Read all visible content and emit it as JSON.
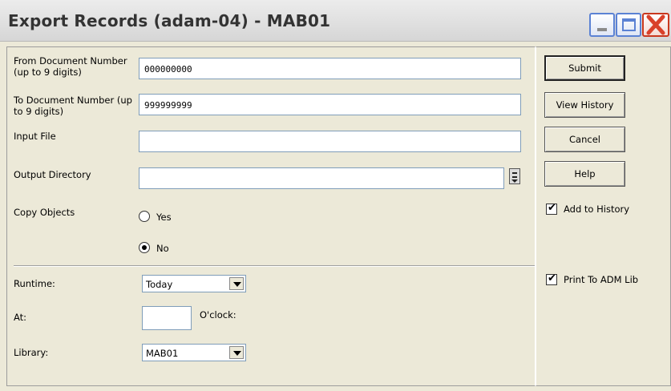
{
  "window": {
    "title": "Export Records (adam-04) - MAB01"
  },
  "form": {
    "from_doc": {
      "label": "From Document Number (up to 9 digits)",
      "value": "000000000"
    },
    "to_doc": {
      "label": "To Document Number (up to 9 digits)",
      "value": "999999999"
    },
    "input_file": {
      "label": "Input File",
      "value": ""
    },
    "output_dir": {
      "label": "Output Directory",
      "value": ""
    },
    "copy_objects": {
      "label": "Copy Objects",
      "options": [
        "Yes",
        "No"
      ],
      "selected": "No"
    },
    "runtime": {
      "label": "Runtime:",
      "value": "Today"
    },
    "at": {
      "label": "At:",
      "value": "",
      "suffix": "O'clock:"
    },
    "library": {
      "label": "Library:",
      "value": "MAB01"
    }
  },
  "side": {
    "buttons": [
      "Submit",
      "View History",
      "Cancel",
      "Help"
    ],
    "add_to_history": {
      "label": "Add to History",
      "checked": true
    },
    "print_to_adm": {
      "label": "Print To ADM Lib",
      "checked": true
    }
  },
  "icons": [
    "minimize-icon",
    "maximize-icon",
    "close-icon",
    "folder-picker-icon",
    "dropdown-arrow-icon",
    "checkmark-icon"
  ],
  "colors": {
    "close": "#c9381f",
    "accent": "#5b82d4"
  }
}
